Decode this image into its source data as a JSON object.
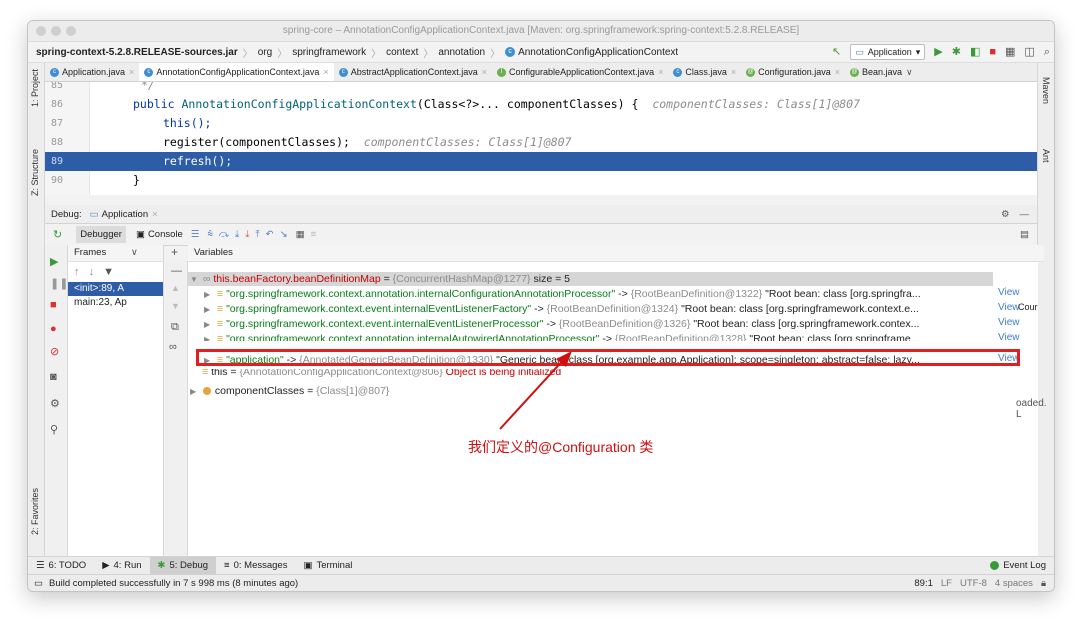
{
  "window": {
    "title": "spring-core – AnnotationConfigApplicationContext.java [Maven: org.springframework:spring-context:5.2.8.RELEASE]"
  },
  "breadcrumb": [
    "spring-context-5.2.8.RELEASE-sources.jar",
    "org",
    "springframework",
    "context",
    "annotation",
    "AnnotationConfigApplicationContext"
  ],
  "run_config": "Application",
  "tabs": [
    {
      "label": "Application.java"
    },
    {
      "label": "AnnotationConfigApplicationContext.java"
    },
    {
      "label": "AbstractApplicationContext.java"
    },
    {
      "label": "ConfigurableApplicationContext.java"
    },
    {
      "label": "Class.java"
    },
    {
      "label": "Configuration.java"
    },
    {
      "label": "Bean.java"
    }
  ],
  "left_strip": {
    "project": "1: Project",
    "structure": "Z: Structure",
    "favorites": "2: Favorites"
  },
  "right_strip": {
    "maven": "Maven",
    "ant": "Ant"
  },
  "code": {
    "lines": [
      {
        "num": "85",
        "text": "*/"
      },
      {
        "num": "86",
        "kw": "public",
        "fn": "AnnotationConfigApplicationContext",
        "rest": "(Class<?>... componentClasses) {",
        "hint": "componentClasses: Class[1]@807"
      },
      {
        "num": "87",
        "text": "this();"
      },
      {
        "num": "88",
        "text": "register(componentClasses);",
        "hint": "componentClasses: Class[1]@807"
      },
      {
        "num": "89",
        "text": "refresh();"
      },
      {
        "num": "90",
        "text": "}"
      }
    ]
  },
  "debug": {
    "label": "Debug:",
    "session": "Application",
    "debugger_tab": "Debugger",
    "console_tab": "Console",
    "frames_header": "Frames",
    "variables_header": "Variables",
    "frames": [
      "<init>:89, A",
      "main:23, Ap"
    ]
  },
  "variables": [
    {
      "name": "this.beanFactory.beanDefinitionMap",
      "eq": " = ",
      "val": "{ConcurrentHashMap@1277}",
      "extra": "  size = 5"
    },
    {
      "key": "\"org.springframework.context.annotation.internalConfigurationAnnotationProcessor\"",
      "arrow": " -> ",
      "ref": "{RootBeanDefinition@1322}",
      "desc": " \"Root bean: class [org.springfra...",
      "view": "View"
    },
    {
      "key": "\"org.springframework.context.event.internalEventListenerFactory\"",
      "arrow": " -> ",
      "ref": "{RootBeanDefinition@1324}",
      "desc": " \"Root bean: class [org.springframework.context.e...",
      "view": "View"
    },
    {
      "key": "\"org.springframework.context.event.internalEventListenerProcessor\"",
      "arrow": " -> ",
      "ref": "{RootBeanDefinition@1326}",
      "desc": " \"Root bean: class [org.springframework.contex...",
      "view": "View"
    },
    {
      "key": "\"org.springframework.context.annotation.internalAutowiredAnnotationProcessor\"",
      "arrow": " -> ",
      "ref": "{RootBeanDefinition@1328}",
      "desc": " \"Root bean: class [org.springframe...",
      "view": "View"
    },
    {
      "key": "\"application\"",
      "arrow": " -> ",
      "ref": "{AnnotatedGenericBeanDefinition@1330}",
      "desc": " \"Generic bean: class [org.example.app.Application]; scope=singleton; abstract=false; lazy...",
      "view": "View"
    },
    {
      "name": "this",
      "eq": " = ",
      "val": "{AnnotationConfigApplicationContext@806}",
      "extra": " Object is being initialized"
    },
    {
      "name": "componentClasses",
      "eq": " = ",
      "val": "{Class[1]@807}"
    }
  ],
  "right_panel": {
    "cour": "Cour",
    "loaded": "oaded. L"
  },
  "annotation": "我们定义的@Configuration 类",
  "bottom_tabs": [
    "6: TODO",
    "4: Run",
    "5: Debug",
    "0: Messages",
    "Terminal"
  ],
  "event_log": "Event Log",
  "status": {
    "message": "Build completed successfully in 7 s 998 ms (8 minutes ago)",
    "position": "89:1",
    "line_sep": "LF",
    "encoding": "UTF-8",
    "indent": "4 spaces"
  },
  "colors": {
    "selection": "#2e5da8",
    "highlight_box": "#e02020",
    "annotation": "#d01010"
  }
}
